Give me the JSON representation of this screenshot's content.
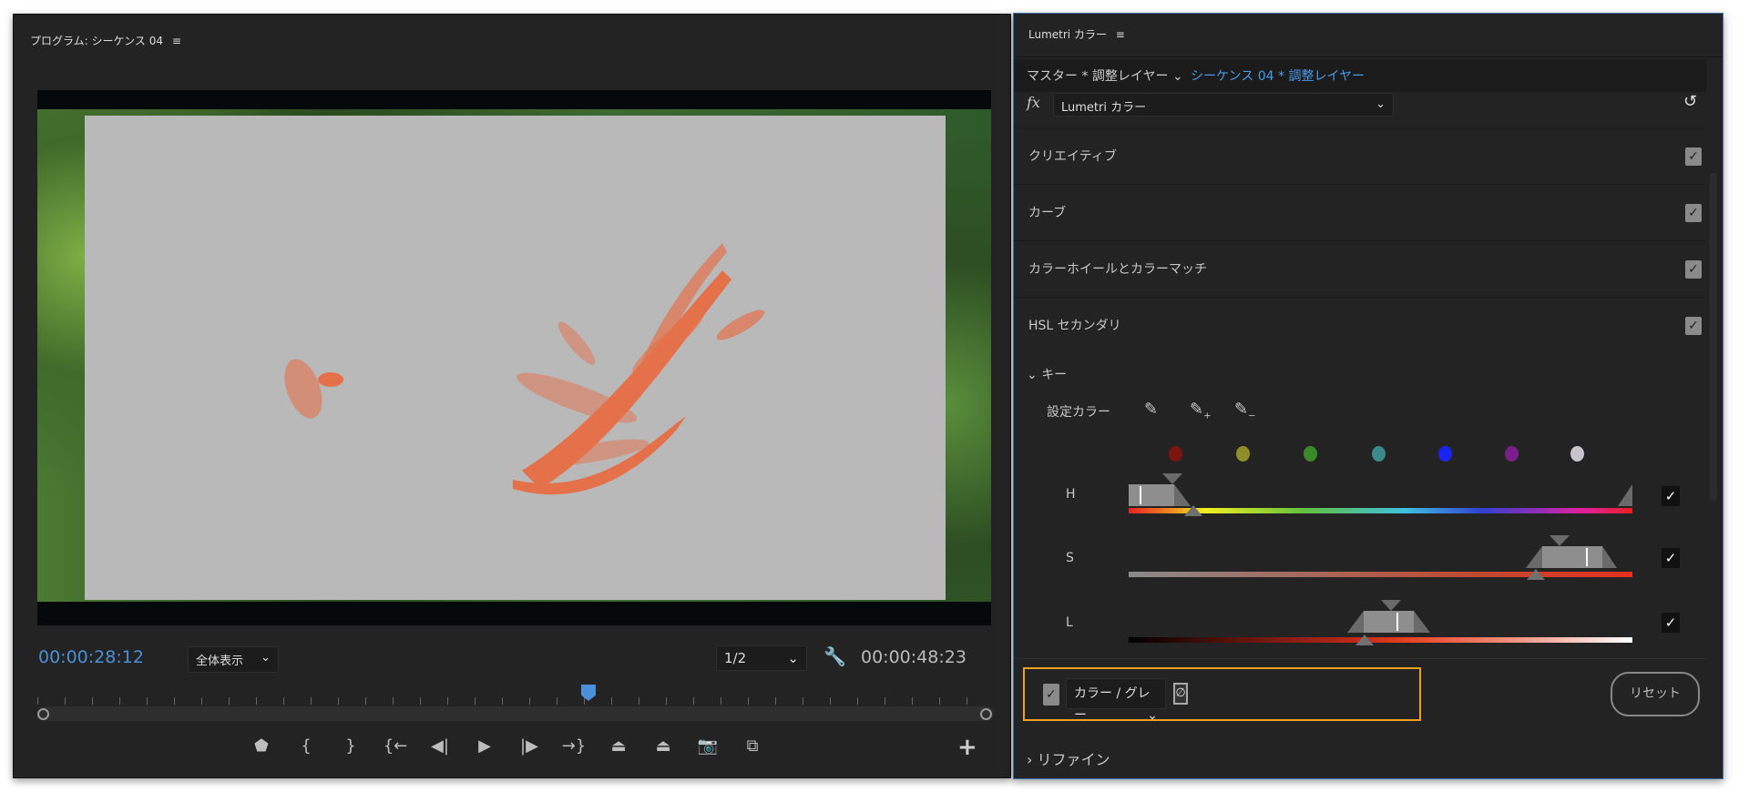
{
  "program_monitor": {
    "title": "プログラム: シーケンス 04",
    "menu_icon": "hamburger-icon",
    "current_timecode": "00:00:28:12",
    "zoom_select": "全体表示",
    "resolution_select": "1/2",
    "duration_timecode": "00:00:48:23",
    "playhead_fraction": 0.58,
    "controls": [
      "marker-icon",
      "mark-in-icon",
      "mark-out-icon",
      "go-to-in-icon",
      "step-back-icon",
      "play-icon",
      "step-forward-icon",
      "go-to-out-icon",
      "lift-icon",
      "extract-icon",
      "camera-icon",
      "comparison-view-icon",
      "add-icon"
    ]
  },
  "lumetri": {
    "title": "Lumetri カラー",
    "master_clip": "マスター * 調整レイヤー",
    "sequence_clip": "シーケンス 04 * 調整レイヤー",
    "fx_label": "fx",
    "effect_select": "Lumetri カラー",
    "sections": [
      {
        "label": "クリエイティブ",
        "checked": true
      },
      {
        "label": "カーブ",
        "checked": true
      },
      {
        "label": "カラーホイールとカラーマッチ",
        "checked": true
      },
      {
        "label": "HSL セカンダリ",
        "checked": true
      }
    ],
    "key": {
      "label": "キー",
      "set_color_label": "設定カラー",
      "swatches": [
        "#7a1512",
        "#8f8f2a",
        "#3a8a2a",
        "#3a8a8a",
        "#1a24f0",
        "#7a1f8a",
        "#c8c4cc"
      ],
      "sliders": [
        {
          "label": "H",
          "range": [
            0.0,
            0.1
          ],
          "checked": true
        },
        {
          "label": "S",
          "range": [
            0.8,
            1.0
          ],
          "checked": true
        },
        {
          "label": "L",
          "range": [
            0.45,
            0.65
          ],
          "checked": true
        }
      ]
    },
    "display_checked": true,
    "display_mode": "カラー / グレー",
    "reset_label": "リセット",
    "refine_label": "リファイン",
    "accent": "#f0a020",
    "timecode_color": "#4a8fd8"
  }
}
